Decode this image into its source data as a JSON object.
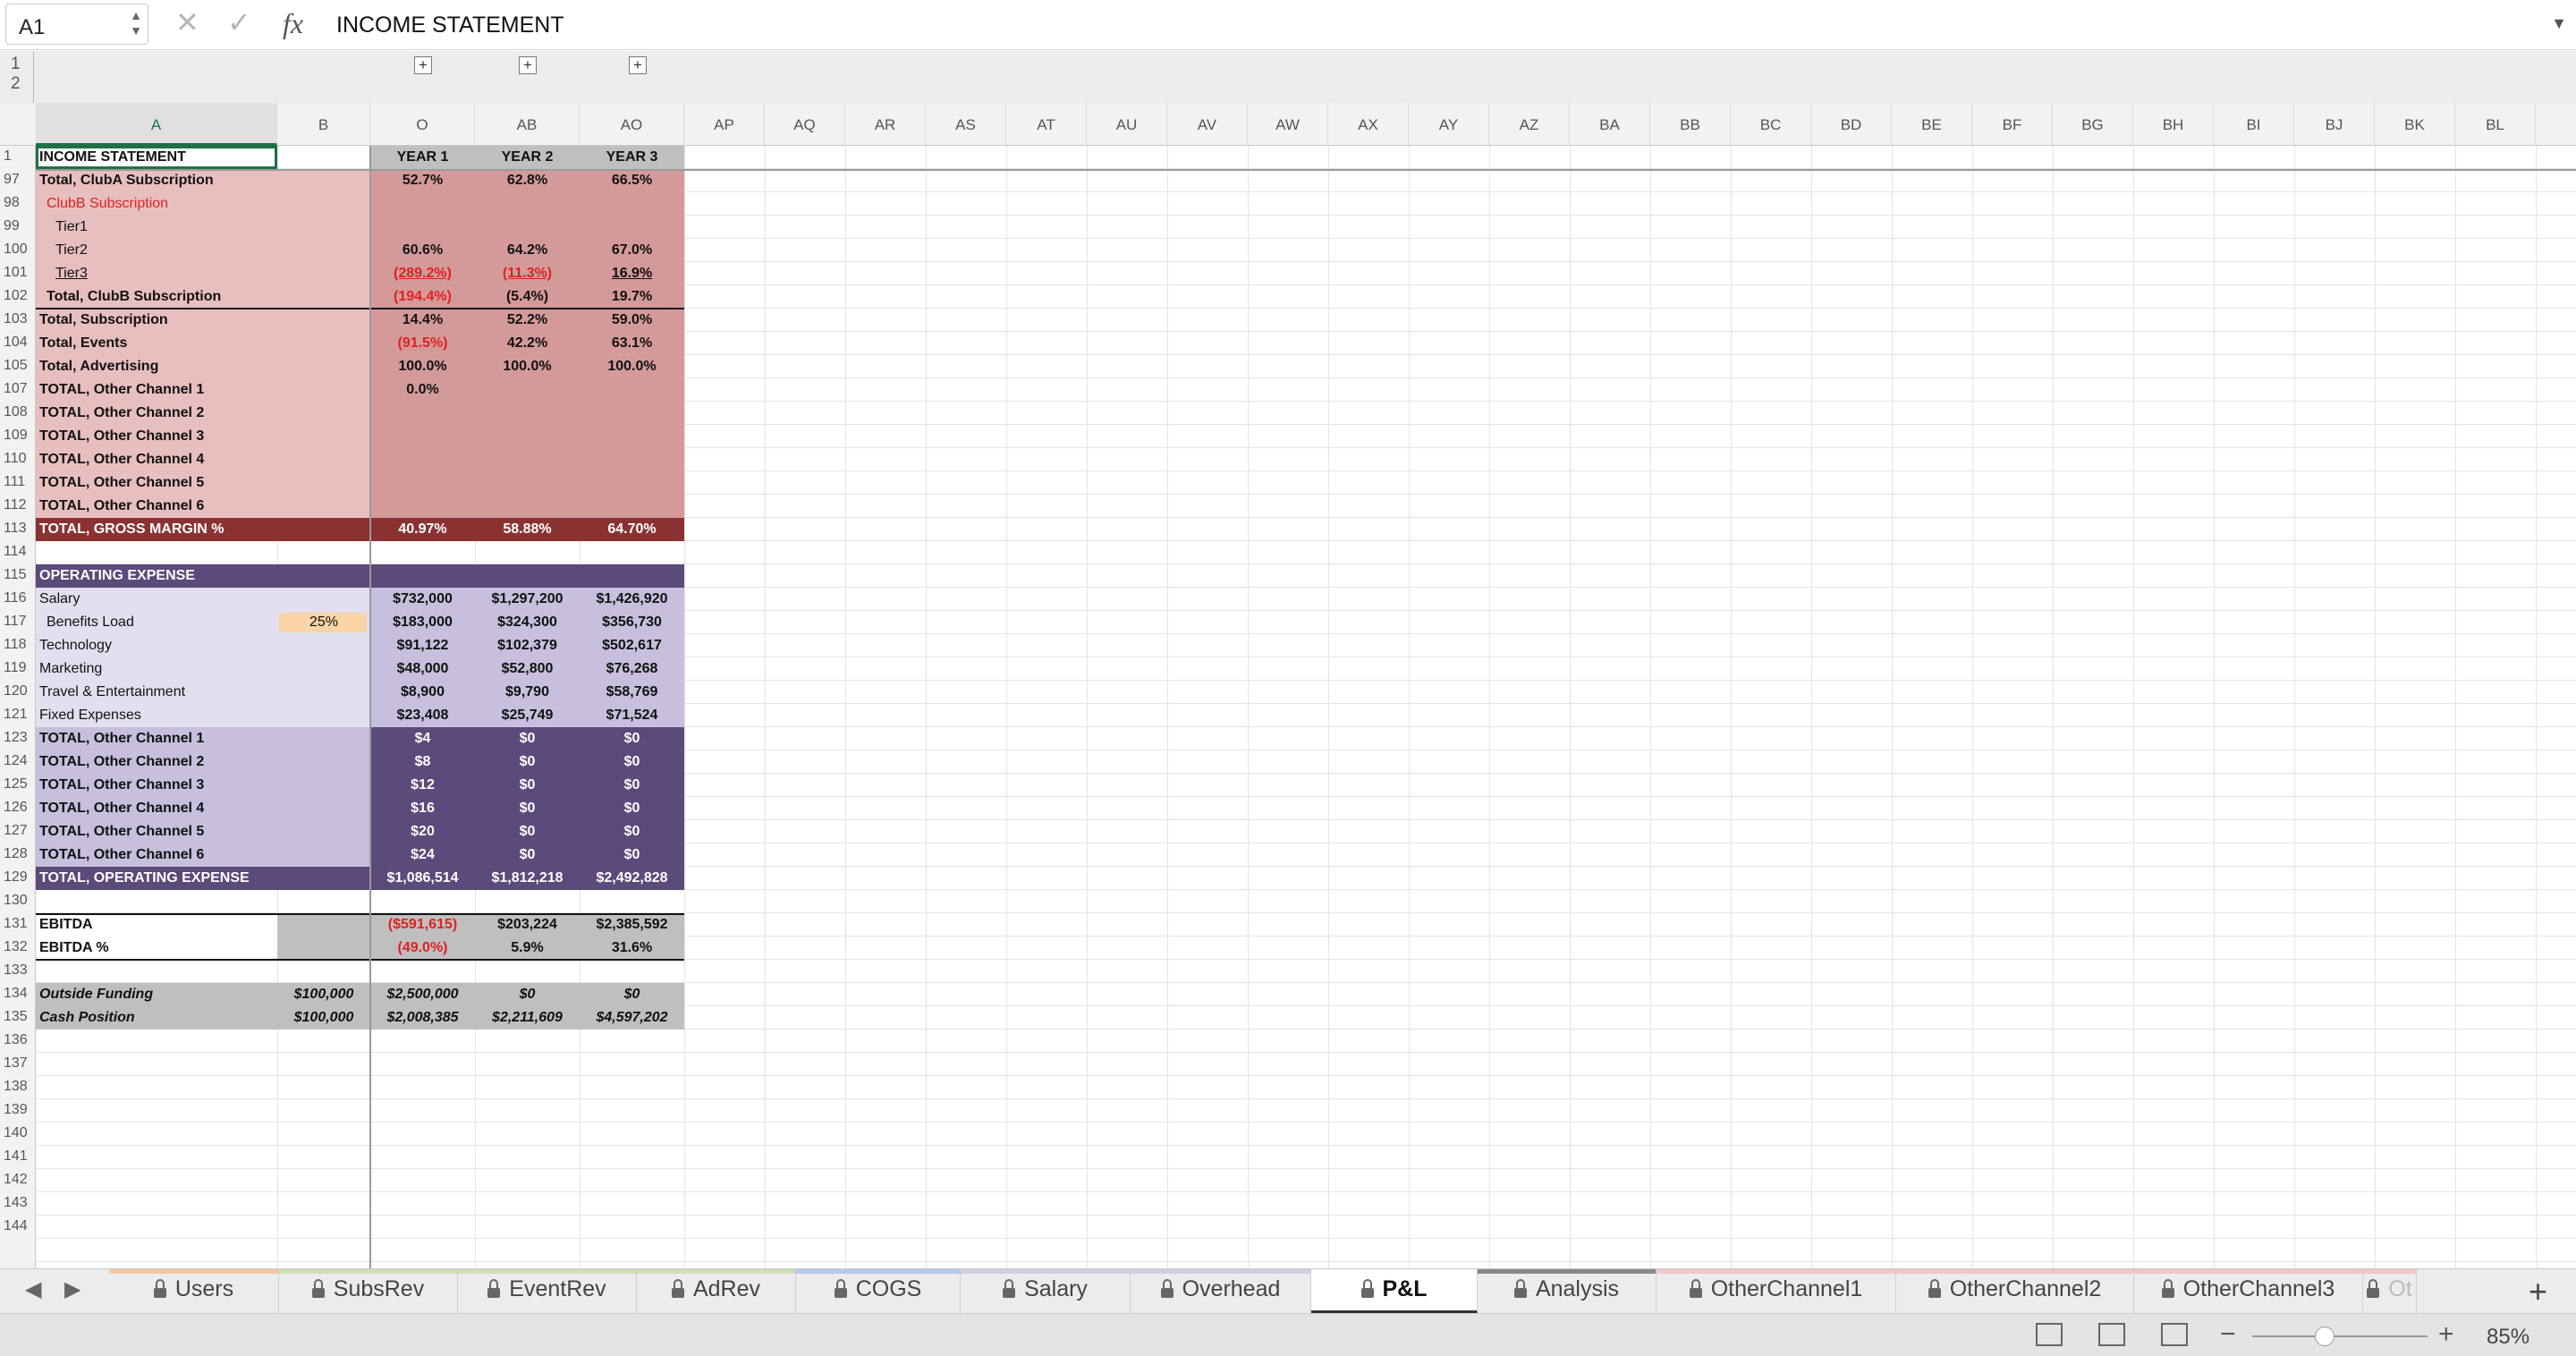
{
  "namebox": "A1",
  "formula": "INCOME STATEMENT",
  "group_levels": [
    "1",
    "2"
  ],
  "columns": [
    "A",
    "B",
    "O",
    "AB",
    "AO",
    "AP",
    "AQ",
    "AR",
    "AS",
    "AT",
    "AU",
    "AV",
    "AW",
    "AX",
    "AY",
    "AZ",
    "BA",
    "BB",
    "BC",
    "BD",
    "BE",
    "BF",
    "BG",
    "BH",
    "BI",
    "BJ",
    "BK",
    "BL"
  ],
  "row_numbers": [
    "1",
    "97",
    "98",
    "99",
    "100",
    "101",
    "102",
    "103",
    "104",
    "105",
    "107",
    "108",
    "109",
    "110",
    "111",
    "112",
    "113",
    "114",
    "115",
    "116",
    "117",
    "118",
    "119",
    "120",
    "121",
    "123",
    "124",
    "125",
    "126",
    "127",
    "128",
    "129",
    "130",
    "131",
    "132",
    "133",
    "134",
    "135",
    "136",
    "137",
    "138",
    "139",
    "140",
    "141",
    "142",
    "143",
    "144"
  ],
  "rows": [
    {
      "a": "INCOME STATEMENT",
      "o": "YEAR 1",
      "ab": "YEAR 2",
      "ao": "YEAR 3"
    },
    {
      "a": "Total, ClubA Subscription",
      "o": "52.7%",
      "ab": "62.8%",
      "ao": "66.5%"
    },
    {
      "a": "ClubB Subscription"
    },
    {
      "a": "Tier1"
    },
    {
      "a": "Tier2",
      "o": "60.6%",
      "ab": "64.2%",
      "ao": "67.0%"
    },
    {
      "a": "Tier3",
      "o": "(289.2%)",
      "ab": "(11.3%)",
      "ao": "16.9%"
    },
    {
      "a": "Total, ClubB Subscription",
      "o": "(194.4%)",
      "ab": "(5.4%)",
      "ao": "19.7%"
    },
    {
      "a": "Total, Subscription",
      "o": "14.4%",
      "ab": "52.2%",
      "ao": "59.0%"
    },
    {
      "a": "Total, Events",
      "o": "(91.5%)",
      "ab": "42.2%",
      "ao": "63.1%"
    },
    {
      "a": "Total, Advertising",
      "o": "100.0%",
      "ab": "100.0%",
      "ao": "100.0%"
    },
    {
      "a": "TOTAL, Other Channel 1",
      "o": "0.0%"
    },
    {
      "a": "TOTAL, Other Channel 2"
    },
    {
      "a": "TOTAL, Other Channel 3"
    },
    {
      "a": "TOTAL, Other Channel 4"
    },
    {
      "a": "TOTAL, Other Channel 5"
    },
    {
      "a": "TOTAL, Other Channel 6"
    },
    {
      "a": "TOTAL, GROSS MARGIN %",
      "o": "40.97%",
      "ab": "58.88%",
      "ao": "64.70%"
    },
    {
      "a": ""
    },
    {
      "a": "OPERATING EXPENSE"
    },
    {
      "a": "Salary",
      "o": "$732,000",
      "ab": "$1,297,200",
      "ao": "$1,426,920"
    },
    {
      "a": "Benefits Load",
      "b": "25%",
      "o": "$183,000",
      "ab": "$324,300",
      "ao": "$356,730"
    },
    {
      "a": "Technology",
      "o": "$91,122",
      "ab": "$102,379",
      "ao": "$502,617"
    },
    {
      "a": "Marketing",
      "o": "$48,000",
      "ab": "$52,800",
      "ao": "$76,268"
    },
    {
      "a": "Travel & Entertainment",
      "o": "$8,900",
      "ab": "$9,790",
      "ao": "$58,769"
    },
    {
      "a": "Fixed Expenses",
      "o": "$23,408",
      "ab": "$25,749",
      "ao": "$71,524"
    },
    {
      "a": "TOTAL, Other Channel 1",
      "o": "$4",
      "ab": "$0",
      "ao": "$0"
    },
    {
      "a": "TOTAL, Other Channel 2",
      "o": "$8",
      "ab": "$0",
      "ao": "$0"
    },
    {
      "a": "TOTAL, Other Channel 3",
      "o": "$12",
      "ab": "$0",
      "ao": "$0"
    },
    {
      "a": "TOTAL, Other Channel 4",
      "o": "$16",
      "ab": "$0",
      "ao": "$0"
    },
    {
      "a": "TOTAL, Other Channel 5",
      "o": "$20",
      "ab": "$0",
      "ao": "$0"
    },
    {
      "a": "TOTAL, Other Channel 6",
      "o": "$24",
      "ab": "$0",
      "ao": "$0"
    },
    {
      "a": "TOTAL, OPERATING EXPENSE",
      "o": "$1,086,514",
      "ab": "$1,812,218",
      "ao": "$2,492,828"
    },
    {
      "a": ""
    },
    {
      "a": "EBITDA",
      "o": "($591,615)",
      "ab": "$203,224",
      "ao": "$2,385,592"
    },
    {
      "a": "EBITDA %",
      "o": "(49.0%)",
      "ab": "5.9%",
      "ao": "31.6%"
    },
    {
      "a": ""
    },
    {
      "a": "Outside Funding",
      "b": "$100,000",
      "o": "$2,500,000",
      "ab": "$0",
      "ao": "$0"
    },
    {
      "a": "Cash Position",
      "b": "$100,000",
      "o": "$2,008,385",
      "ab": "$2,211,609",
      "ao": "$4,597,202"
    }
  ],
  "tabs": [
    {
      "label": "Users",
      "color": "#f4c6a0"
    },
    {
      "label": "SubsRev",
      "color": "#cfe0b4"
    },
    {
      "label": "EventRev",
      "color": "#cfe0b4"
    },
    {
      "label": "AdRev",
      "color": "#cfe0b4"
    },
    {
      "label": "COGS",
      "color": "#b4c8ec"
    },
    {
      "label": "Salary",
      "color": "#d2cce4"
    },
    {
      "label": "Overhead",
      "color": "#d2cce4"
    },
    {
      "label": "P&L",
      "color": "#ffffff"
    },
    {
      "label": "Analysis",
      "color": "#888888"
    },
    {
      "label": "OtherChannel1",
      "color": "#f2c6c6"
    },
    {
      "label": "OtherChannel2",
      "color": "#f2c6c6"
    },
    {
      "label": "OtherChannel3",
      "color": "#f2c6c6"
    },
    {
      "label": "Ot",
      "color": "#f2c6c6"
    }
  ],
  "zoom": "85%",
  "colors": {
    "pink_light": "#e8bfbf",
    "pink_dark": "#d49a9a",
    "maroon": "#8a3232",
    "purple_dark": "#5b4a7a",
    "purple_light": "#e3dff0",
    "purple_mid": "#c8bedd",
    "grey": "#bfbfbf",
    "orange": "#f9d4a6"
  }
}
